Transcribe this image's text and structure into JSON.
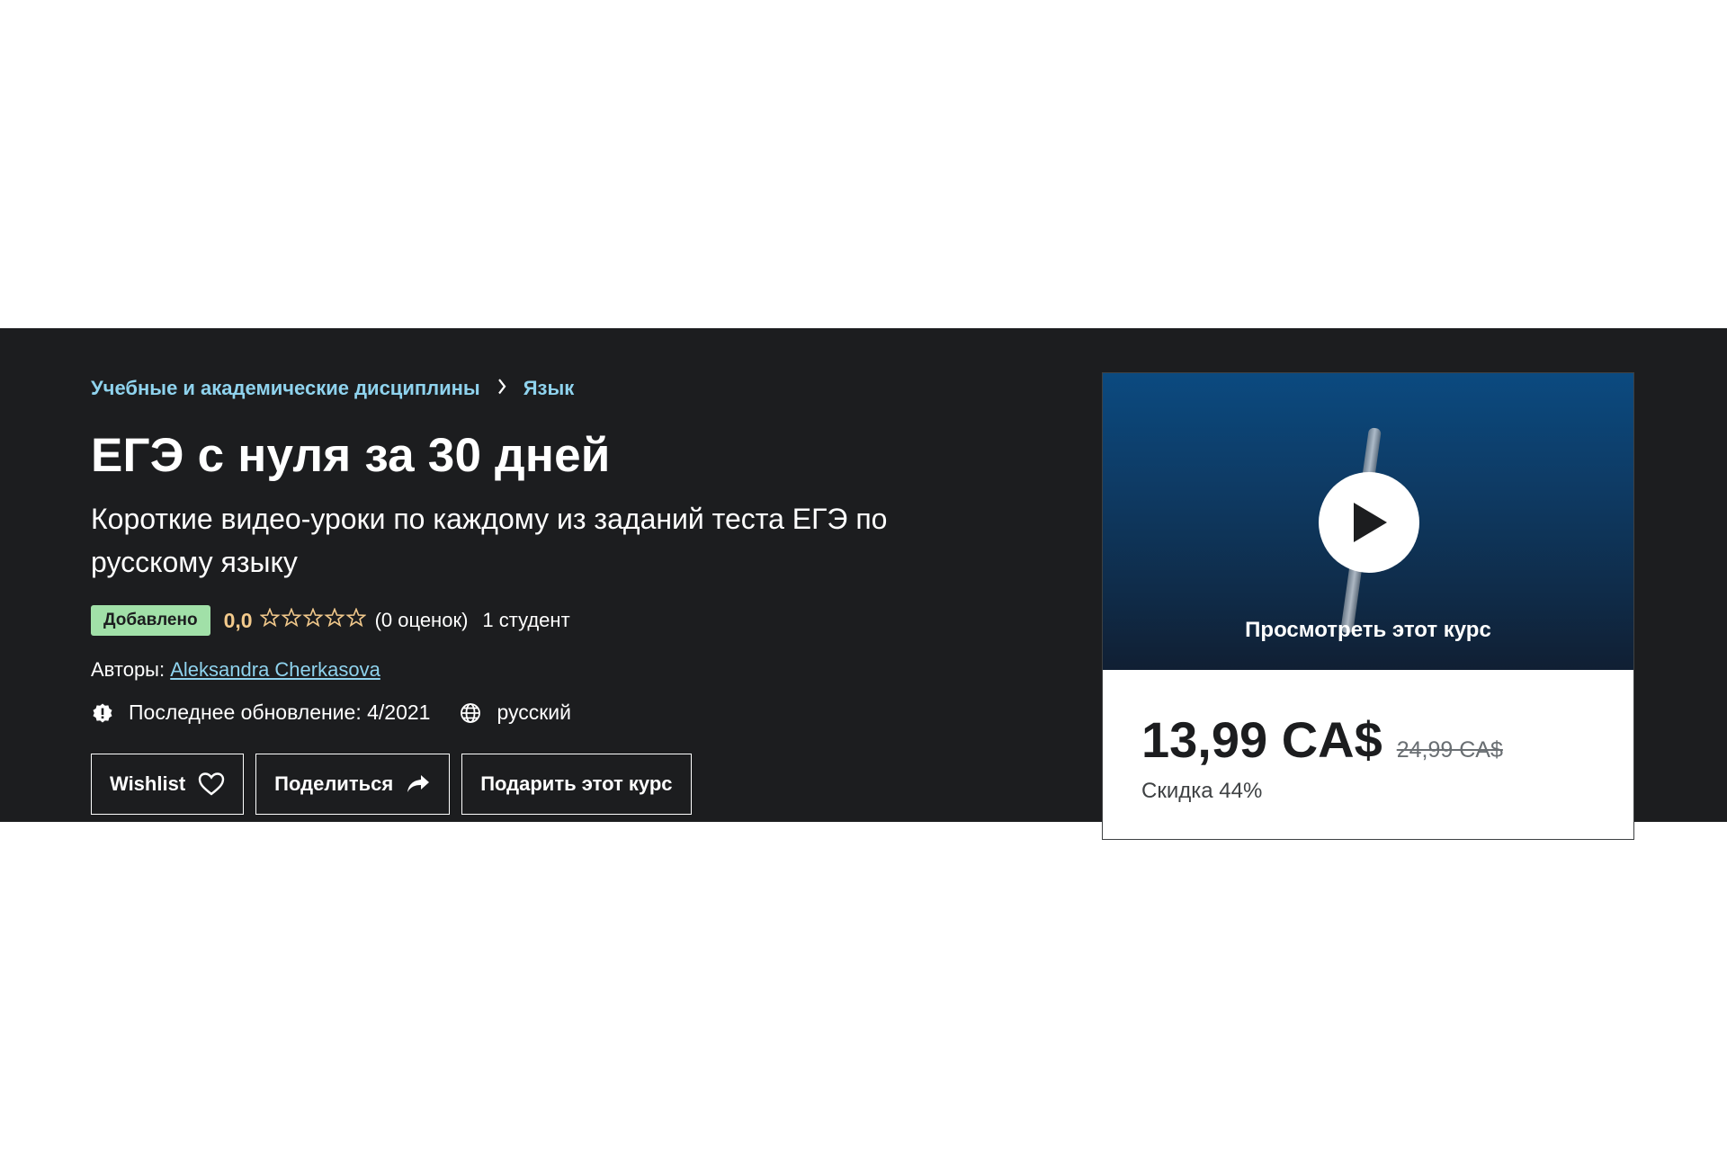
{
  "breadcrumb": {
    "items": [
      "Учебные и академические дисциплины",
      "Язык"
    ]
  },
  "course": {
    "title": "ЕГЭ с нуля за 30 дней",
    "subtitle": "Короткие видео-уроки по каждому из заданий теста ЕГЭ по русскому языку",
    "badge": "Добавлено",
    "rating": "0,0",
    "rating_stars": 0,
    "rating_count": "(0 оценок)",
    "students": "1 студент",
    "authors_label": "Авторы:",
    "author_name": "Aleksandra Cherkasova",
    "last_update": "Последнее обновление: 4/2021",
    "language": "русский"
  },
  "actions": {
    "wishlist": "Wishlist",
    "share": "Поделиться",
    "gift": "Подарить этот курс"
  },
  "card": {
    "preview_label": "Просмотреть этот курс",
    "price": "13,99 CA$",
    "old_price": "24,99 CA$",
    "discount": "Скидка 44%"
  },
  "colors": {
    "banner_bg": "#1c1d1f",
    "link": "#8fd3ee",
    "rating": "#f3ca8c",
    "badge_bg": "#a1e0a8"
  },
  "icons": {
    "breadcrumb_sep": "chevron-right-icon",
    "update": "alert-badge-icon",
    "language": "globe-icon",
    "wishlist": "heart-icon",
    "share": "share-arrow-icon",
    "preview": "play-icon"
  }
}
